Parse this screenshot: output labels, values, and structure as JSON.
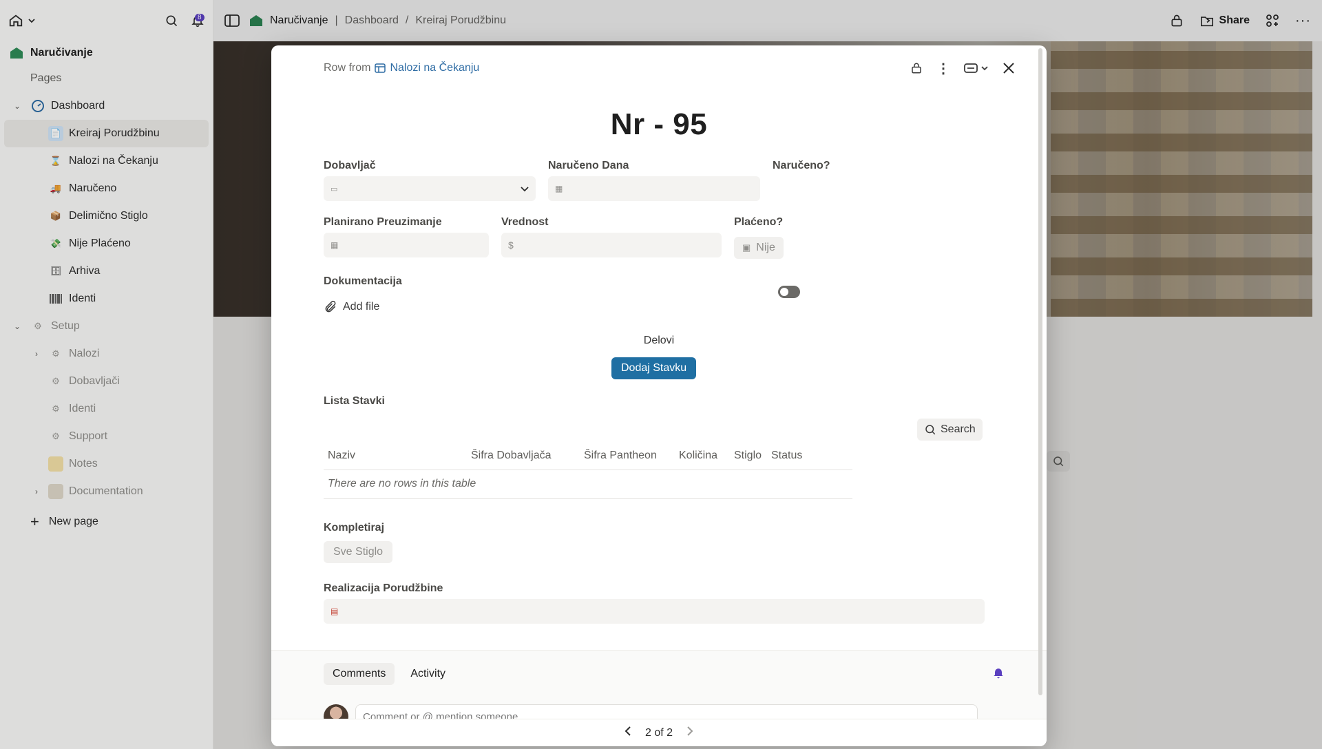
{
  "sidebar": {
    "workspace": "Naručivanje",
    "notifications_count": "8",
    "pages_label": "Pages",
    "items": [
      {
        "label": "Dashboard"
      },
      {
        "label": "Kreiraj Porudžbinu"
      },
      {
        "label": "Nalozi na Čekanju"
      },
      {
        "label": "Naručeno"
      },
      {
        "label": "Delimično Stiglo"
      },
      {
        "label": "Nije Plaćeno"
      },
      {
        "label": "Arhiva"
      },
      {
        "label": "Identi"
      },
      {
        "label": "Setup"
      },
      {
        "label": "Nalozi"
      },
      {
        "label": "Dobavljači"
      },
      {
        "label": "Identi"
      },
      {
        "label": "Support"
      },
      {
        "label": "Notes"
      },
      {
        "label": "Documentation"
      }
    ],
    "new_page": "New page"
  },
  "topbar": {
    "workspace": "Naručivanje",
    "crumb1": "Dashboard",
    "sep": "/",
    "crumb2": "Kreiraj Porudžbinu",
    "share": "Share"
  },
  "modal": {
    "row_from": "Row from",
    "source_db": "Nalozi na Čekanju",
    "title": "Nr - 95",
    "fields": {
      "dobavljac": "Dobavljač",
      "naruceno_dana": "Naručeno Dana",
      "naruceno_q": "Naručeno?",
      "planirano": "Planirano Preuzimanje",
      "vrednost": "Vrednost",
      "vrednost_prefix": "$",
      "placeno_q": "Plaćeno?",
      "placeno_value": "Nije",
      "dokumentacija": "Dokumentacija",
      "add_file": "Add file",
      "delovi": "Delovi",
      "dodaj_stavku": "Dodaj Stavku",
      "lista_stavki": "Lista Stavki",
      "search": "Search",
      "kompletiraj": "Kompletiraj",
      "sve_stiglo": "Sve Stiglo",
      "realizacija": "Realizacija Porudžbine"
    },
    "table": {
      "columns": [
        "Naziv",
        "Šifra Dobavljača",
        "Šifra Pantheon",
        "Količina",
        "Stiglo",
        "Status"
      ],
      "empty": "There are no rows in this table"
    },
    "footer": {
      "tab_comments": "Comments",
      "tab_activity": "Activity",
      "comment_placeholder": "Comment or @ mention someone",
      "pager": "2 of 2"
    }
  },
  "colors": {
    "accent": "#1f6fa3",
    "link": "#2e6ca4",
    "badge": "#5a3fbf"
  }
}
